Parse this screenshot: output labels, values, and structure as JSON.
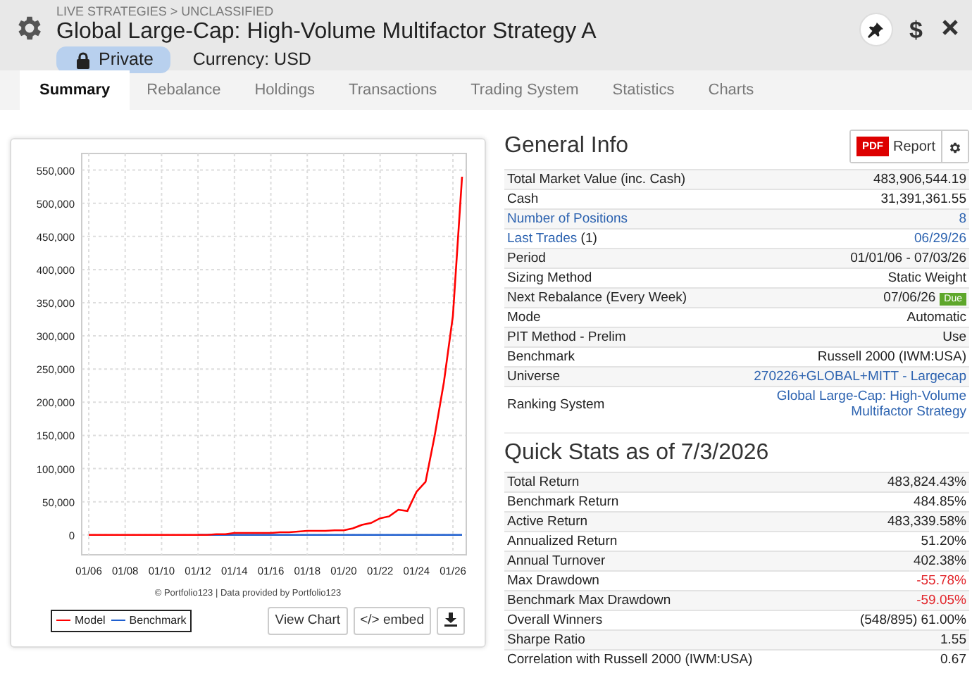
{
  "header": {
    "breadcrumb": "LIVE STRATEGIES > UNCLASSIFIED",
    "title": "Global Large-Cap: High-Volume Multifactor Strategy A",
    "privacy": "Private",
    "currency": "Currency: USD",
    "dollar_button": "$"
  },
  "tabs": [
    {
      "label": "Summary",
      "selected": true
    },
    {
      "label": "Rebalance",
      "selected": false
    },
    {
      "label": "Holdings",
      "selected": false
    },
    {
      "label": "Transactions",
      "selected": false
    },
    {
      "label": "Trading System",
      "selected": false
    },
    {
      "label": "Statistics",
      "selected": false
    },
    {
      "label": "Charts",
      "selected": false
    }
  ],
  "chart": {
    "credit": "© Portfolio123 | Data provided by Portfolio123",
    "buttons": [
      "View Chart",
      "</> embed"
    ],
    "chart_data": {
      "type": "line",
      "categories": [
        "01/06",
        null,
        null,
        null,
        "01/08",
        null,
        null,
        null,
        "01/10",
        null,
        null,
        null,
        "01/12",
        null,
        null,
        null,
        "01/14",
        null,
        null,
        null,
        "01/16",
        null,
        null,
        null,
        "01/18",
        null,
        null,
        null,
        "01/20",
        null,
        null,
        null,
        "01/22",
        null,
        null,
        null,
        "01/24",
        null,
        null,
        null,
        "01/26",
        null
      ],
      "series": [
        {
          "name": "Model",
          "color": "#ff0000",
          "values": [
            0,
            0,
            0,
            0,
            0,
            0,
            0,
            0,
            0,
            0,
            0,
            0,
            0,
            0,
            1000,
            1000,
            3000,
            3000,
            3000,
            3000,
            3000,
            4000,
            4000,
            5000,
            6000,
            6000,
            6000,
            7000,
            7000,
            10000,
            15000,
            18000,
            25000,
            28000,
            38000,
            36000,
            65000,
            80000,
            150000,
            230000,
            330000,
            540000
          ]
        },
        {
          "name": "Benchmark",
          "color": "#1f5fcf",
          "values": [
            null,
            null,
            null,
            null,
            null,
            null,
            null,
            null,
            null,
            null,
            null,
            null,
            0,
            0,
            0,
            0,
            0,
            0,
            0,
            0,
            0,
            0,
            0,
            0,
            0,
            0,
            0,
            0,
            0,
            0,
            0,
            0,
            0,
            0,
            0,
            0,
            0,
            0,
            0,
            0,
            0,
            0
          ]
        }
      ],
      "ylim": [
        -30000,
        575000
      ],
      "grid": true,
      "yticks": [
        {
          "value": 0,
          "label": "0"
        },
        {
          "value": 50000,
          "label": "50,000"
        },
        {
          "value": 100000,
          "label": "100,000"
        },
        {
          "value": 150000,
          "label": "150,000"
        },
        {
          "value": 200000,
          "label": "200,000"
        },
        {
          "value": 250000,
          "label": "250,000"
        },
        {
          "value": 300000,
          "label": "300,000"
        },
        {
          "value": 350000,
          "label": "350,000"
        },
        {
          "value": 400000,
          "label": "400,000"
        },
        {
          "value": 450000,
          "label": "450,000"
        },
        {
          "value": 500000,
          "label": "500,000"
        },
        {
          "value": 550000,
          "label": "550,000"
        }
      ]
    }
  },
  "general_info": {
    "title": "General Info",
    "report_badge": "PDF",
    "report_label": "Report",
    "rows": [
      {
        "label": "Total Market Value (inc. Cash)",
        "value": "483,906,544.19",
        "label_link": false,
        "value_link": false
      },
      {
        "label": "Cash",
        "value": "31,391,361.55",
        "label_link": false,
        "value_link": false
      },
      {
        "label": "Number of Positions",
        "value": "8",
        "label_link": true,
        "value_link": true
      },
      {
        "label": "Last Trades",
        "label_suffix": "(1)",
        "value": "06/29/26",
        "label_link": true,
        "value_link": true
      },
      {
        "label": "Period",
        "value": "01/01/06 - 07/03/26",
        "label_link": false,
        "value_link": false
      },
      {
        "label": "Sizing Method",
        "value": "Static Weight",
        "label_link": false,
        "value_link": false
      },
      {
        "label": "Next Rebalance (Every Week)",
        "value": "07/06/26",
        "badge": "Due",
        "label_link": false,
        "value_link": false
      },
      {
        "label": "Mode",
        "value": "Automatic",
        "label_link": false,
        "value_link": false
      },
      {
        "label": "PIT Method - Prelim",
        "value": "Use",
        "label_link": false,
        "value_link": false
      },
      {
        "label": "Benchmark",
        "value": "Russell 2000 (IWM:USA)",
        "label_link": false,
        "value_link": false
      },
      {
        "label": "Universe",
        "value": "270226+GLOBAL+MITT - Largecap",
        "label_link": false,
        "value_link": true
      },
      {
        "label": "Ranking System",
        "value": "Global Large-Cap: High-Volume Multifactor Strategy",
        "label_link": false,
        "value_link": true
      }
    ]
  },
  "quick_stats": {
    "title": "Quick Stats as of 7/3/2026",
    "rows": [
      {
        "label": "Total Return",
        "value": "483,824.43%",
        "negative": false
      },
      {
        "label": "Benchmark Return",
        "value": "484.85%",
        "negative": false
      },
      {
        "label": "Active Return",
        "value": "483,339.58%",
        "negative": false
      },
      {
        "label": "Annualized Return",
        "value": "51.20%",
        "negative": false
      },
      {
        "label": "Annual Turnover",
        "value": "402.38%",
        "negative": false
      },
      {
        "label": "Max Drawdown",
        "value": "-55.78%",
        "negative": true
      },
      {
        "label": "Benchmark Max Drawdown",
        "value": "-59.05%",
        "negative": true
      },
      {
        "label": "Overall Winners",
        "value": "(548/895) 61.00%",
        "negative": false
      },
      {
        "label": "Sharpe Ratio",
        "value": "1.55",
        "negative": false
      },
      {
        "label": "Correlation with Russell 2000 (IWM:USA)",
        "value": "0.67",
        "negative": false
      }
    ]
  }
}
